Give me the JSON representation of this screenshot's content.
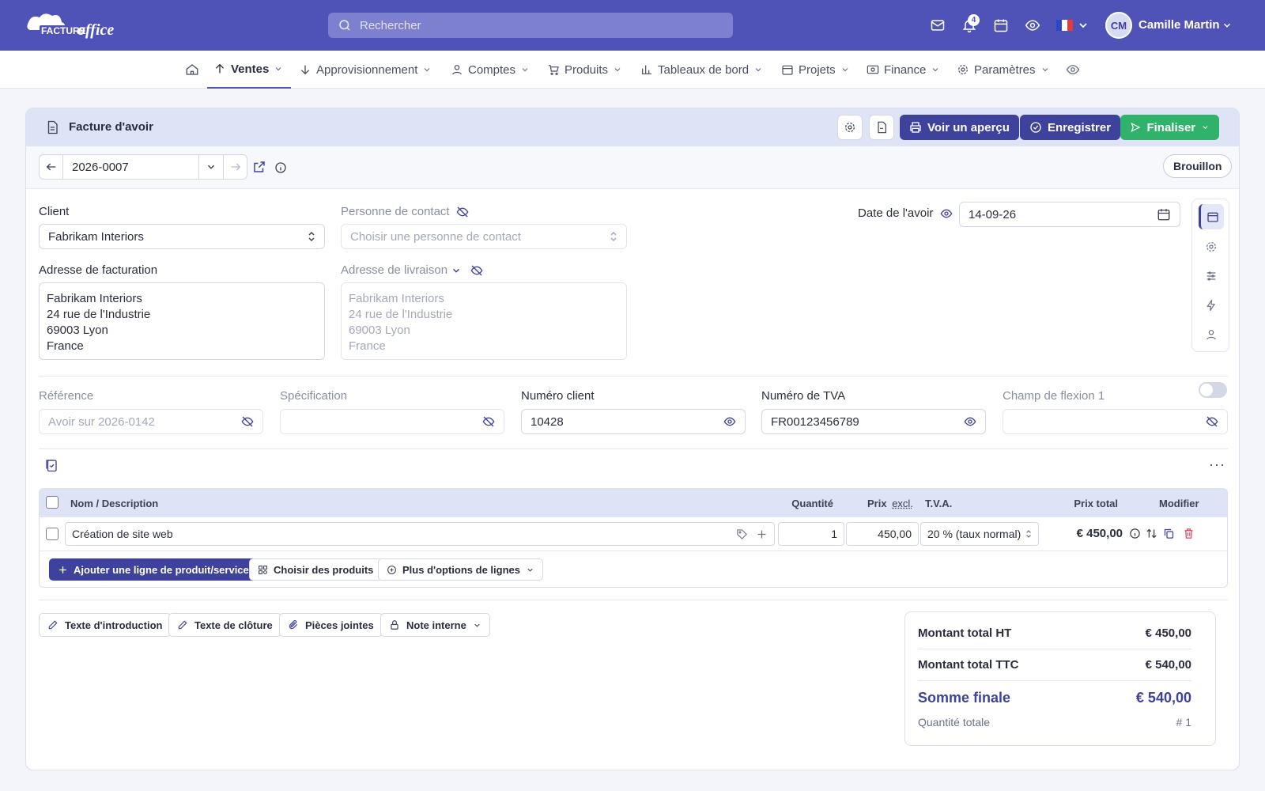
{
  "topbar": {
    "logo_text": "FACTUREoffice",
    "search_placeholder": "Rechercher",
    "notification_count": "4",
    "avatar_initials": "CM",
    "user_name": "Camille Martin"
  },
  "nav": {
    "items": [
      {
        "label": "Ventes",
        "active": true
      },
      {
        "label": "Approvisionnement"
      },
      {
        "label": "Comptes"
      },
      {
        "label": "Produits"
      },
      {
        "label": "Tableaux de bord"
      },
      {
        "label": "Projets"
      },
      {
        "label": "Finance"
      },
      {
        "label": "Paramètres"
      }
    ]
  },
  "doc": {
    "title": "Facture d'avoir",
    "preview_label": "Voir un aperçu",
    "save_label": "Enregistrer",
    "finalize_label": "Finaliser",
    "number": "2026-0007",
    "status": "Brouillon"
  },
  "form": {
    "client_label": "Client",
    "client_value": "Fabrikam Interiors",
    "contact_label": "Personne de contact",
    "contact_placeholder": "Choisir une personne de contact",
    "date_label": "Date de l'avoir",
    "date_value": "14-09-26",
    "billing_label": "Adresse de facturation",
    "billing_address": [
      "Fabrikam Interiors",
      "24 rue de l'Industrie",
      "69003 Lyon",
      "France"
    ],
    "delivery_label": "Adresse de livraison",
    "delivery_address": [
      "Fabrikam Interiors",
      "24 rue de l'Industrie",
      "69003 Lyon",
      "France"
    ],
    "reference_label": "Référence",
    "reference_placeholder": "Avoir sur 2026-0142",
    "spec_label": "Spécification",
    "client_number_label": "Numéro client",
    "client_number_value": "10428",
    "vat_label": "Numéro de TVA",
    "vat_value": "FR00123456789",
    "flex_label": "Champ de flexion 1"
  },
  "table": {
    "headers": {
      "name": "Nom / Description",
      "qty": "Quantité",
      "price": "Prix",
      "price_excl": "excl.",
      "vat": "T.V.A.",
      "total": "Prix total",
      "edit": "Modifier"
    },
    "rows": [
      {
        "name": "Création de site web",
        "qty": "1",
        "price": "450,00",
        "vat": "20 % (taux normal)",
        "total": "€ 450,00"
      }
    ],
    "add_line_label": "Ajouter une ligne de produit/service",
    "choose_products_label": "Choisir des produits",
    "more_options_label": "Plus d'options de lignes"
  },
  "bottom_tabs": {
    "intro": "Texte d'introduction",
    "closing": "Texte de clôture",
    "attachments": "Pièces jointes",
    "internal_note": "Note interne"
  },
  "totals": {
    "ht_label": "Montant total HT",
    "ht_value": "€ 450,00",
    "ttc_label": "Montant total TTC",
    "ttc_value": "€ 540,00",
    "final_label": "Somme finale",
    "final_value": "€ 540,00",
    "qty_label": "Quantité totale",
    "qty_value": "# 1"
  },
  "colors": {
    "brand": "#4f53b8",
    "primary_button": "#3e429c",
    "finalize_button": "#2fb36b",
    "delete_icon": "#e0465a"
  }
}
